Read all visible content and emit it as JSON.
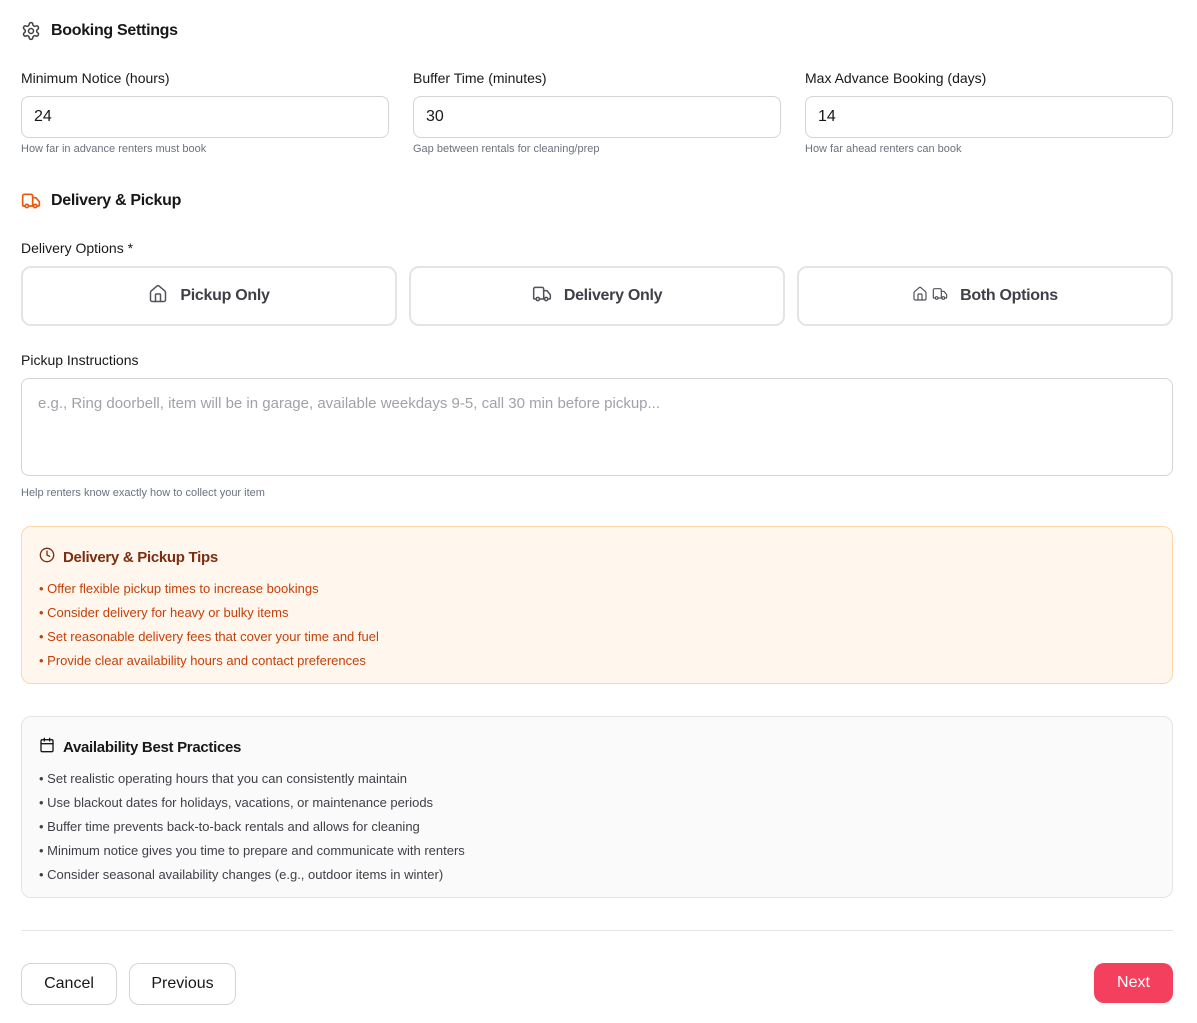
{
  "booking": {
    "title": "Booking Settings",
    "fields": [
      {
        "label": "Minimum Notice (hours)",
        "value": "24",
        "hint": "How far in advance renters must book"
      },
      {
        "label": "Buffer Time (minutes)",
        "value": "30",
        "hint": "Gap between rentals for cleaning/prep"
      },
      {
        "label": "Max Advance Booking (days)",
        "value": "14",
        "hint": "How far ahead renters can book"
      }
    ]
  },
  "delivery": {
    "title": "Delivery & Pickup",
    "options_label": "Delivery Options *",
    "options": [
      "Pickup Only",
      "Delivery Only",
      "Both Options"
    ],
    "instructions_label": "Pickup Instructions",
    "instructions_placeholder": "e.g., Ring doorbell, item will be in garage, available weekdays 9-5, call 30 min before pickup...",
    "instructions_hint": "Help renters know exactly how to collect your item"
  },
  "tips": {
    "title": "Delivery & Pickup Tips",
    "items": [
      "• Offer flexible pickup times to increase bookings",
      "• Consider delivery for heavy or bulky items",
      "• Set reasonable delivery fees that cover your time and fuel",
      "• Provide clear availability hours and contact preferences"
    ]
  },
  "best_practices": {
    "title": "Availability Best Practices",
    "items": [
      "• Set realistic operating hours that you can consistently maintain",
      "• Use blackout dates for holidays, vacations, or maintenance periods",
      "• Buffer time prevents back-to-back rentals and allows for cleaning",
      "• Minimum notice gives you time to prepare and communicate with renters",
      "• Consider seasonal availability changes (e.g., outdoor items in winter)"
    ]
  },
  "actions": {
    "cancel": "Cancel",
    "previous": "Previous",
    "next": "Next"
  },
  "colors": {
    "accent": "#f43f5e",
    "delivery_icon": "#ea580c",
    "tip_bg": "#fff7ed",
    "tip_text": "#c2410c"
  }
}
